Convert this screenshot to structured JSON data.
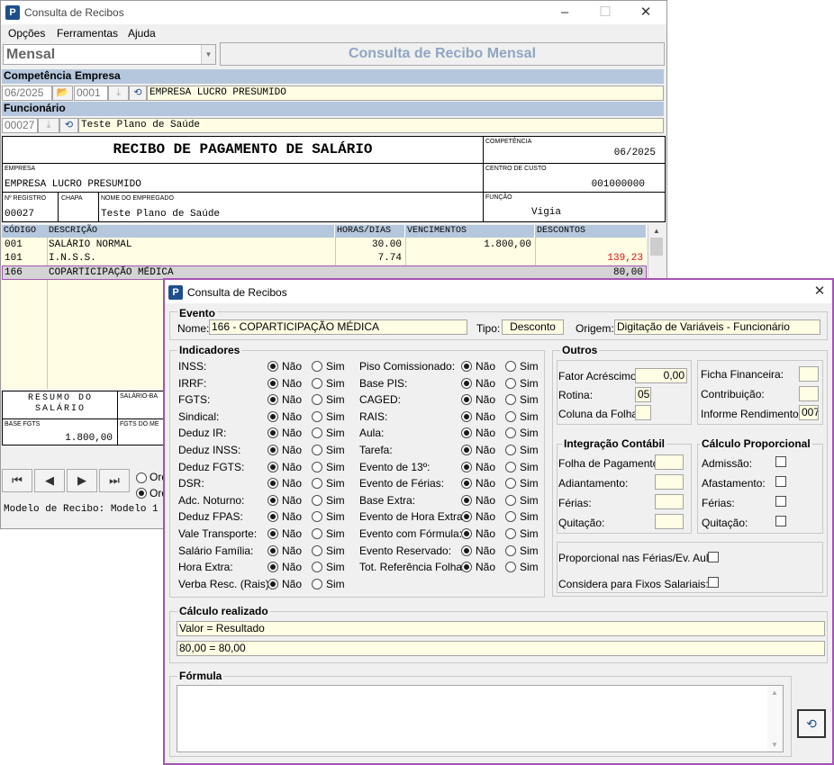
{
  "main": {
    "title": "Consulta de Recibos",
    "menu": [
      "Opções",
      "Ferramentas",
      "Ajuda"
    ],
    "mode": "Mensal",
    "header_title": "Consulta de Recibo Mensal",
    "competencia_label": "Competência",
    "empresa_label": "Empresa",
    "competencia": "06/2025",
    "empresa_code": "0001",
    "empresa_name": "EMPRESA LUCRO PRESUMIDO",
    "funcionario_label": "Funcionário",
    "funcionario_code": "00027",
    "funcionario_name": "Teste Plano de Saúde"
  },
  "receipt": {
    "title": "RECIBO DE PAGAMENTO DE SALÁRIO",
    "competencia_label": "COMPETÊNCIA",
    "competencia": "06/2025",
    "empresa_label": "EMPRESA",
    "empresa": "EMPRESA LUCRO PRESUMIDO",
    "centro_label": "CENTRO DE CUSTO",
    "centro": "001000000",
    "registro_label": "Nº REGISTRO",
    "chapa_label": "CHAPA",
    "nome_label": "NOME DO EMPREGADO",
    "registro": "00027",
    "nome": "Teste Plano de Saúde",
    "funcao_label": "FUNÇÃO",
    "funcao": "Vigia",
    "columns": [
      "CÓDIGO",
      "DESCRIÇÃO",
      "HORAS/DIAS",
      "VENCIMENTOS",
      "DESCONTOS"
    ],
    "rows": [
      {
        "code": "001",
        "desc": "SALÁRIO NORMAL",
        "hours": "30.00",
        "venc": "1.800,00",
        "desc_val": ""
      },
      {
        "code": "101",
        "desc": "I.N.S.S.",
        "hours": "7.74",
        "venc": "",
        "desc_val": "139,23"
      },
      {
        "code": "166",
        "desc": "COPARTICIPAÇÃO MÉDICA",
        "hours": "",
        "venc": "",
        "desc_val": "80,00"
      }
    ],
    "resumo_label": "RESUMO DO SALÁRIO",
    "salario_base_label": "SALÁRIO-BA",
    "base_fgts_label": "BASE FGTS",
    "base_fgts": "1.800,00",
    "fgts_mes_label": "FGTS DO ME",
    "ord1": "Ord",
    "ord2": "Ord",
    "status": "Modelo de Recibo: Modelo 1"
  },
  "dialog": {
    "title": "Consulta de Recibos",
    "evento_label": "Evento",
    "nome_label": "Nome:",
    "nome": "166 - COPARTICIPAÇÃO MÉDICA",
    "tipo_label": "Tipo:",
    "tipo": "Desconto",
    "origem_label": "Origem:",
    "origem": "Digitação de Variáveis - Funcionário",
    "indicadores_label": "Indicadores",
    "nao": "Não",
    "sim": "Sim",
    "indicadores_left": [
      "INSS:",
      "IRRF:",
      "FGTS:",
      "Sindical:",
      "Deduz IR:",
      "Deduz INSS:",
      "Deduz FGTS:",
      "DSR:",
      "Adc. Noturno:",
      "Deduz FPAS:",
      "Vale Transporte:",
      "Salário Família:",
      "Hora Extra:",
      "Verba Resc. (Rais):"
    ],
    "indicadores_right": [
      "Piso Comissionado:",
      "Base PIS:",
      "CAGED:",
      "RAIS:",
      "Aula:",
      "Tarefa:",
      "Evento de 13º:",
      "Evento de Férias:",
      "Base Extra:",
      "Evento de Hora Extra:",
      "Evento com Fórmula:",
      "Evento Reservado:",
      "Tot. Referência Folha:"
    ],
    "outros_label": "Outros",
    "fator_label": "Fator Acréscimo:",
    "fator": "0,00",
    "rotina_label": "Rotina:",
    "rotina": "05",
    "coluna_label": "Coluna da Folha:",
    "coluna": "",
    "ficha_label": "Ficha Financeira:",
    "contrib_label": "Contribuição:",
    "informe_label": "Informe Rendimentos:",
    "informe": "007",
    "integracao_label": "Integração Contábil",
    "integracao_items": [
      "Folha de Pagamento:",
      "Adiantamento:",
      "Férias:",
      "Quitação:"
    ],
    "proporcional_label": "Cálculo Proporcional",
    "proporcional_items": [
      "Admissão:",
      "Afastamento:",
      "Férias:",
      "Quitação:"
    ],
    "prop_ferias_label": "Proporcional nas Férias/Ev. Aula:",
    "fixos_label": "Considera para Fixos Salariais:",
    "calculo_label": "Cálculo realizado",
    "calculo_line1": "Valor = Resultado",
    "calculo_line2": "80,00 = 80,00",
    "formula_label": "Fórmula"
  }
}
